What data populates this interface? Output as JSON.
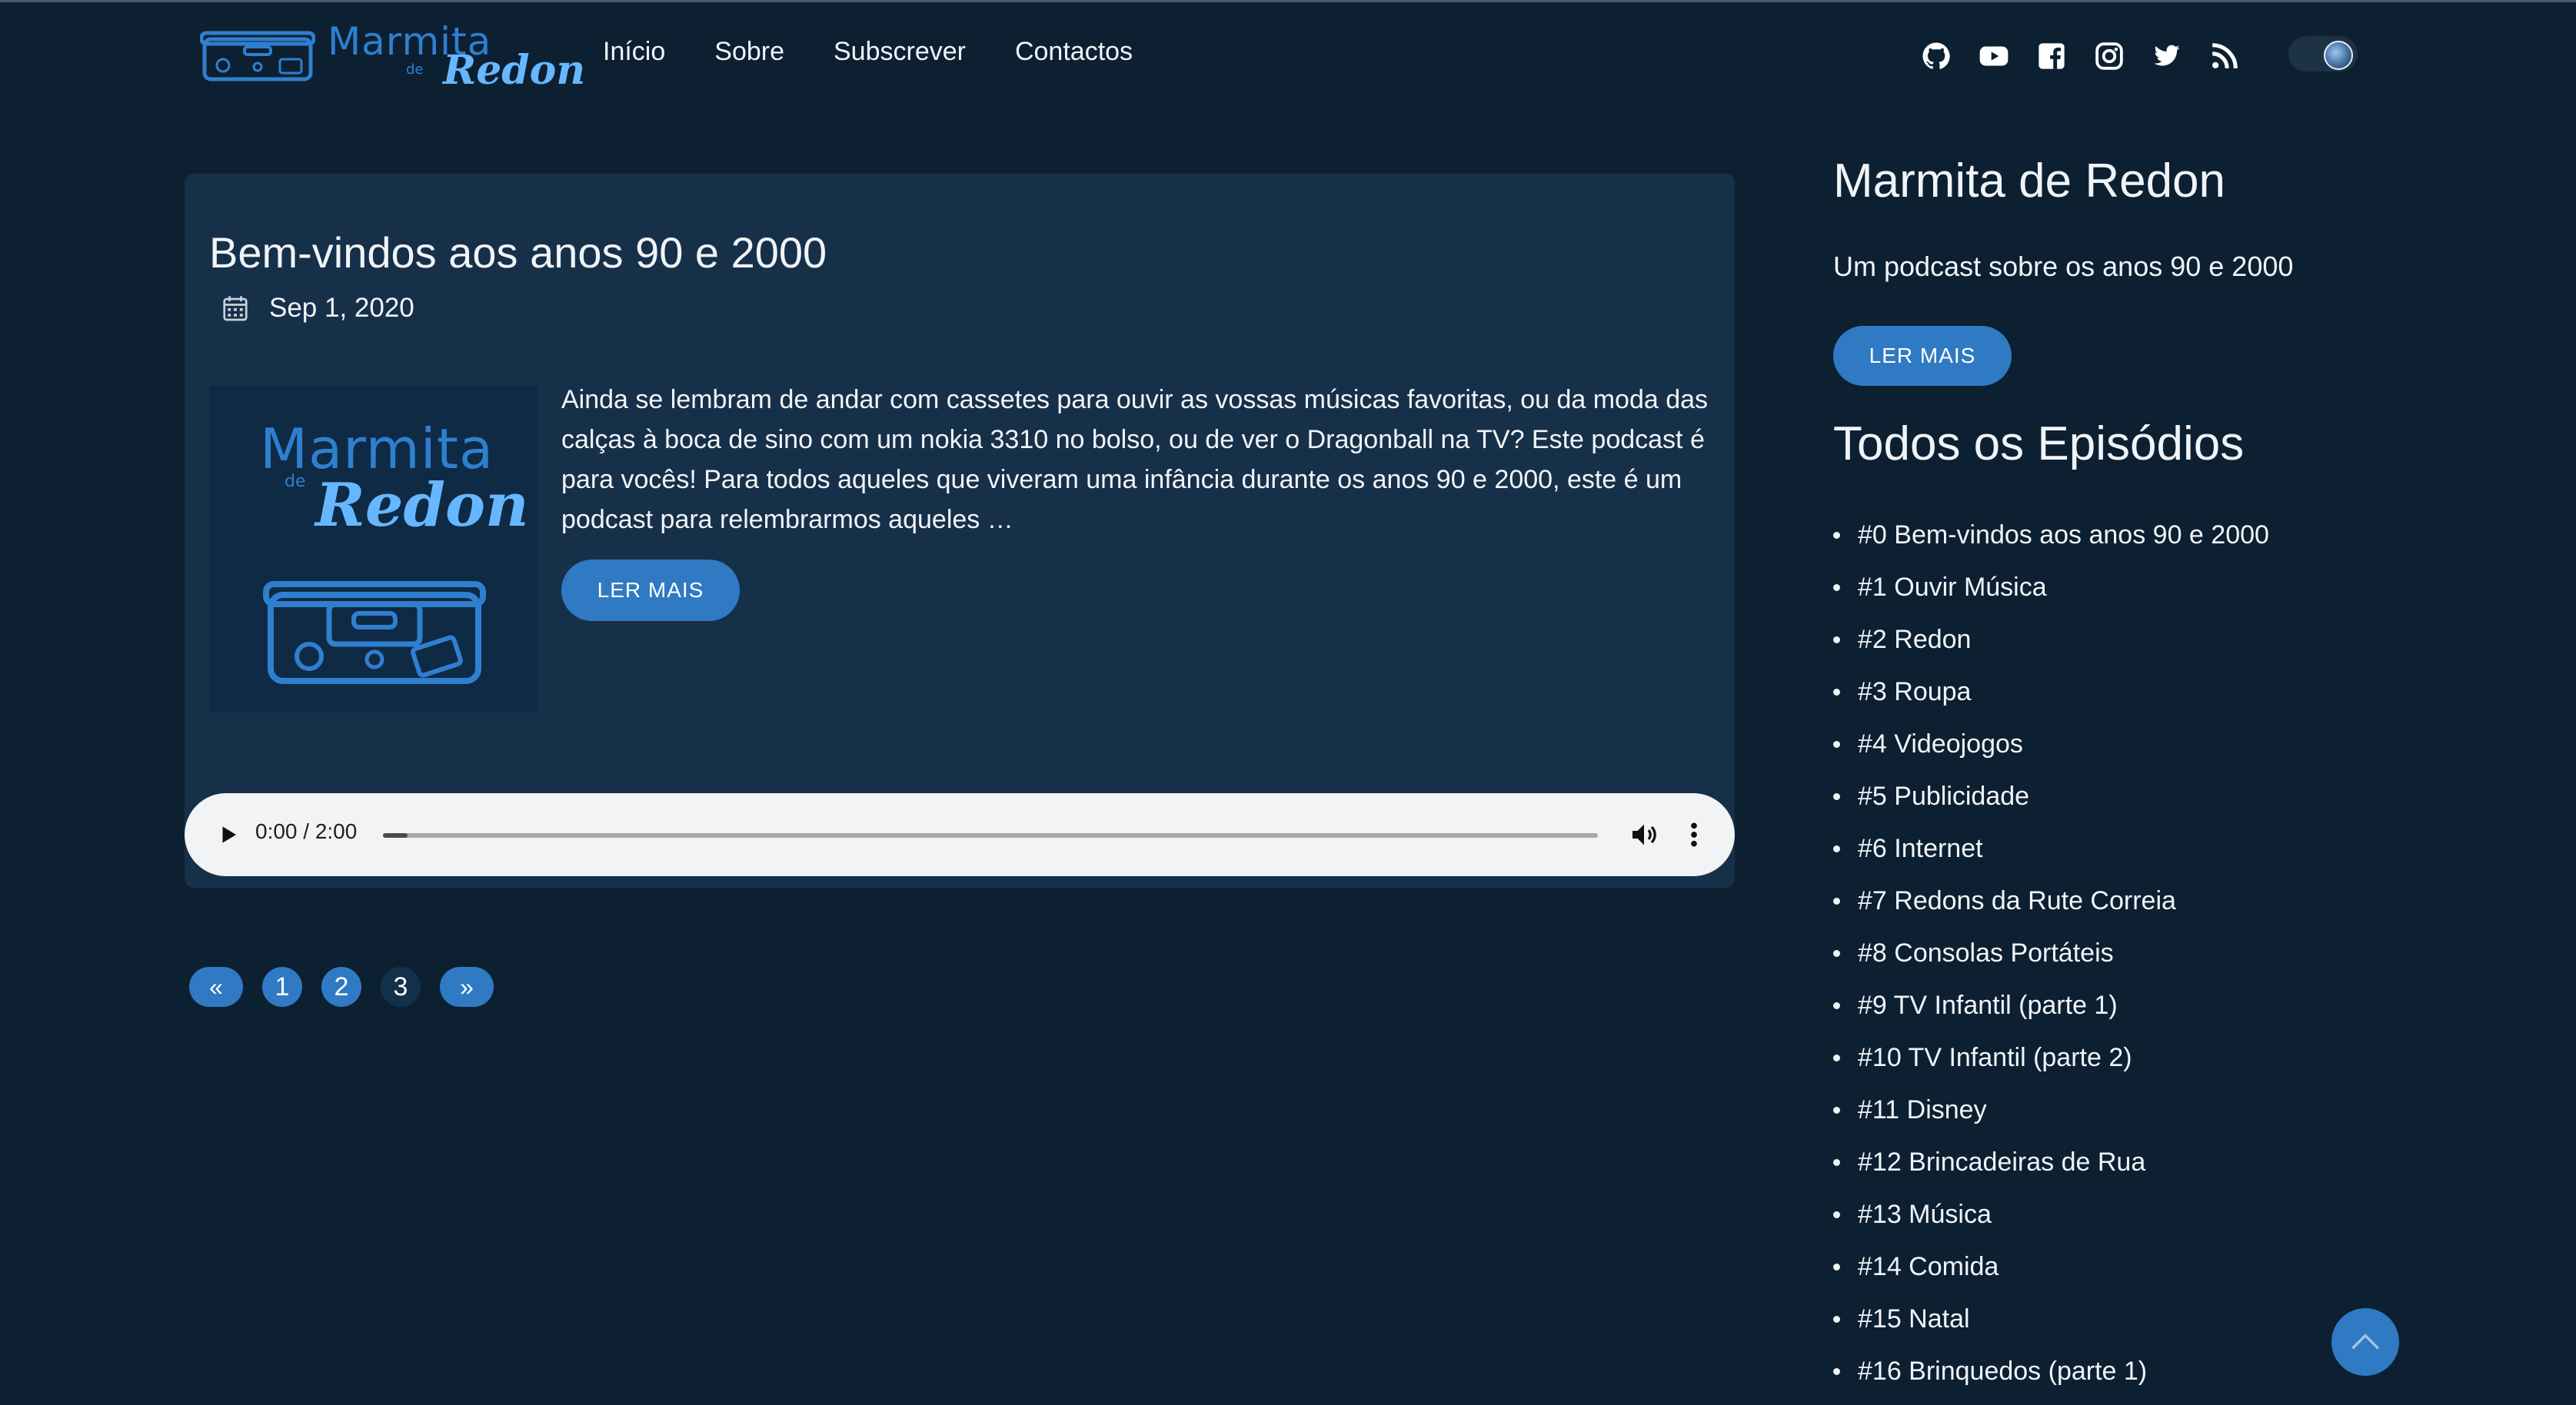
{
  "site": {
    "logo_main": "Marmita",
    "logo_de": "de",
    "logo_sub": "Redon"
  },
  "nav": [
    {
      "label": "Início"
    },
    {
      "label": "Sobre"
    },
    {
      "label": "Subscrever"
    },
    {
      "label": "Contactos"
    }
  ],
  "social_icons": [
    "github-icon",
    "youtube-icon",
    "facebook-icon",
    "instagram-icon",
    "twitter-icon",
    "rss-icon"
  ],
  "theme_toggle": {
    "state": "dark"
  },
  "post": {
    "title": "Bem-vindos aos anos 90 e 2000",
    "date": "Sep 1, 2020",
    "excerpt": "Ainda se lembram de andar com cassetes para ouvir as vossas músicas favoritas, ou da moda das calças à boca de sino com um nokia 3310 no bolso, ou de ver o Dragonball na TV? Este podcast é para vocês! Para todos aqueles que viveram uma infância durante os anos 90 e 2000, este é um podcast para relembrarmos aqueles …",
    "read_more": "LER MAIS",
    "thumb_main": "Marmita",
    "thumb_de": "de",
    "thumb_sub": "Redon"
  },
  "audio": {
    "time": "0:00 / 2:00",
    "progress_fraction": 0.02
  },
  "pagination": {
    "prev": "«",
    "pages": [
      "1",
      "2",
      "3"
    ],
    "next": "»"
  },
  "sidebar": {
    "title": "Marmita de Redon",
    "description": "Um podcast sobre os anos 90 e 2000",
    "read_more": "LER MAIS",
    "episodes_title": "Todos os Episódios",
    "episodes": [
      "#0 Bem-vindos aos anos 90 e 2000",
      "#1 Ouvir Música",
      "#2 Redon",
      "#3 Roupa",
      "#4 Videojogos",
      "#5 Publicidade",
      "#6 Internet",
      "#7 Redons da Rute Correia",
      "#8 Consolas Portáteis",
      "#9 TV Infantil (parte 1)",
      "#10 TV Infantil (parte 2)",
      "#11 Disney",
      "#12 Brincadeiras de Rua",
      "#13 Música",
      "#14 Comida",
      "#15 Natal",
      "#16 Brinquedos (parte 1)"
    ]
  },
  "colors": {
    "background": "#0c2032",
    "card": "#17304a",
    "accent": "#2f7ac3",
    "logo_blue": "#2f7fd0",
    "logo_light": "#66b7ff"
  }
}
